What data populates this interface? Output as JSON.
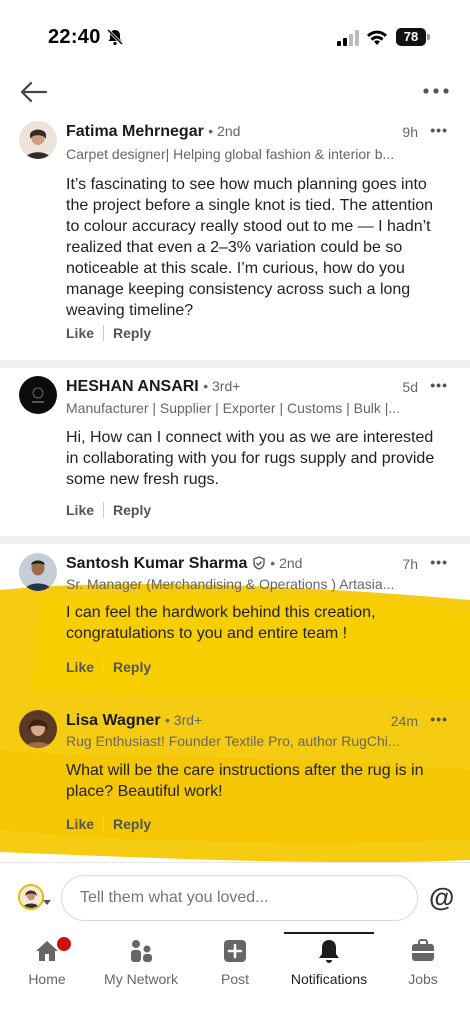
{
  "status_bar": {
    "time": "22:40",
    "battery": "78"
  },
  "comments": [
    {
      "name": "Fatima Mehrnegar",
      "degree": "• 2nd",
      "time": "9h",
      "headline": "Carpet designer| Helping global fashion & interior b...",
      "body": "It’s fascinating to see how much planning goes into the project before a single knot is tied. The attention to colour accuracy really stood out to me — I hadn’t realized that even a 2–3% variation could be so noticeable at this scale. I’m curious, how do you manage keeping consistency across such a long weaving timeline?",
      "like": "Like",
      "reply": "Reply"
    },
    {
      "name": "HESHAN ANSARI",
      "degree": "• 3rd+",
      "time": "5d",
      "headline": "Manufacturer | Supplier | Exporter | Customs | Bulk |...",
      "body": "Hi, How can I connect with you as we are interested in collaborating with you for rugs supply and provide some new fresh rugs.",
      "like": "Like",
      "reply": "Reply"
    },
    {
      "name": "Santosh Kumar Sharma",
      "degree": "• 2nd",
      "time": "7h",
      "headline": "Sr. Manager (Merchandising & Operations ) Artasia...",
      "body": "I can feel the hardwork behind this creation, congratulations to you and entire team  !",
      "like": "Like",
      "reply": "Reply"
    },
    {
      "name": "Lisa Wagner",
      "degree": "• 3rd+",
      "time": "24m",
      "headline": "Rug Enthusiast! Founder Textile Pro, author RugChi...",
      "body": "What will be the care instructions after the rug is in place? Beautiful work!",
      "like": "Like",
      "reply": "Reply"
    }
  ],
  "input": {
    "placeholder": "Tell them what you loved..."
  },
  "tabs": [
    {
      "label": "Home",
      "icon": "home-icon"
    },
    {
      "label": "My Network",
      "icon": "network-icon"
    },
    {
      "label": "Post",
      "icon": "post-icon"
    },
    {
      "label": "Notifications",
      "icon": "bell-icon",
      "active": true
    },
    {
      "label": "Jobs",
      "icon": "briefcase-icon"
    }
  ],
  "colors": {
    "highlighter": "#f5c800",
    "badge": "#cc1016",
    "divider": "#f1efeb"
  }
}
